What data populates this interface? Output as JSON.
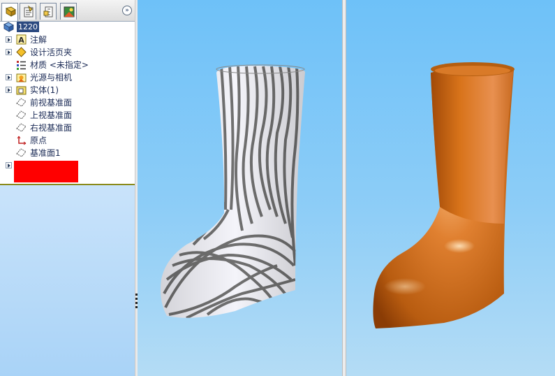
{
  "tabs": [
    {
      "name": "feature-manager",
      "icon": "feature-tree-icon"
    },
    {
      "name": "property-manager",
      "icon": "property-icon"
    },
    {
      "name": "configuration-manager",
      "icon": "configuration-icon"
    },
    {
      "name": "display-manager",
      "icon": "display-icon"
    }
  ],
  "collapse_label": "»",
  "tree": {
    "root": {
      "label": "1220",
      "icon": "part-icon"
    },
    "items": [
      {
        "label": "注解",
        "icon": "annotation-icon",
        "expandable": true
      },
      {
        "label": "设计活页夹",
        "icon": "design-binder-icon",
        "expandable": true
      },
      {
        "label": "材质 <未指定>",
        "icon": "material-icon",
        "expandable": false
      },
      {
        "label": "光源与相机",
        "icon": "lights-cameras-icon",
        "expandable": true
      },
      {
        "label": "实体(1)",
        "icon": "solid-bodies-icon",
        "expandable": true
      },
      {
        "label": "前视基准面",
        "icon": "plane-icon",
        "expandable": false
      },
      {
        "label": "上视基准面",
        "icon": "plane-icon",
        "expandable": false
      },
      {
        "label": "右视基准面",
        "icon": "plane-icon",
        "expandable": false
      },
      {
        "label": "原点",
        "icon": "origin-icon",
        "expandable": false
      },
      {
        "label": "基准面1",
        "icon": "plane-icon",
        "expandable": false
      }
    ]
  },
  "colors": {
    "boot_orange": "#d8731a",
    "selection": "#2c4a80",
    "redaction": "#ff0000"
  }
}
